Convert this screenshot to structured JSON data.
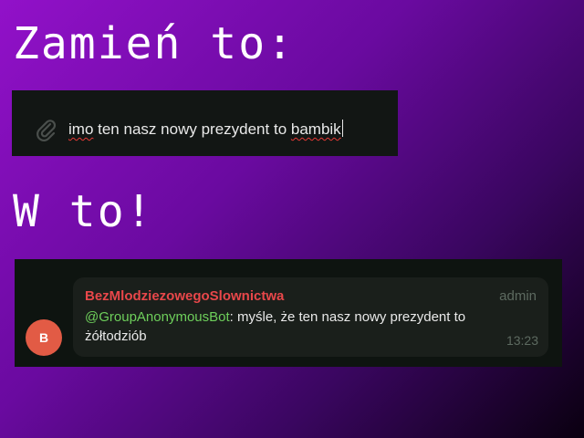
{
  "headings": {
    "top": "Zamień to:",
    "bottom": "W to!"
  },
  "input": {
    "words": [
      {
        "text": "imo",
        "misspelled": true
      },
      {
        "text": " ten ",
        "misspelled": false
      },
      {
        "text": "nasz",
        "misspelled": false
      },
      {
        "text": " ",
        "misspelled": false
      },
      {
        "text": "nowy",
        "misspelled": false
      },
      {
        "text": " ",
        "misspelled": false
      },
      {
        "text": "prezydent",
        "misspelled": false
      },
      {
        "text": " to ",
        "misspelled": false
      },
      {
        "text": "bambik",
        "misspelled": true
      }
    ],
    "attach_icon": "paperclip-icon"
  },
  "message": {
    "sender": "BezMlodziezowegoSlownictwa",
    "role": "admin",
    "avatar_letter": "B",
    "mention": "@GroupAnonymousBot",
    "text": ": myśle, że ten nasz nowy prezydent to żółtodziób",
    "time": "13:23"
  },
  "colors": {
    "sender": "#e8474a",
    "mention": "#6ecf5b",
    "avatar": "#e25b45",
    "spellcheck": "#e53935"
  }
}
